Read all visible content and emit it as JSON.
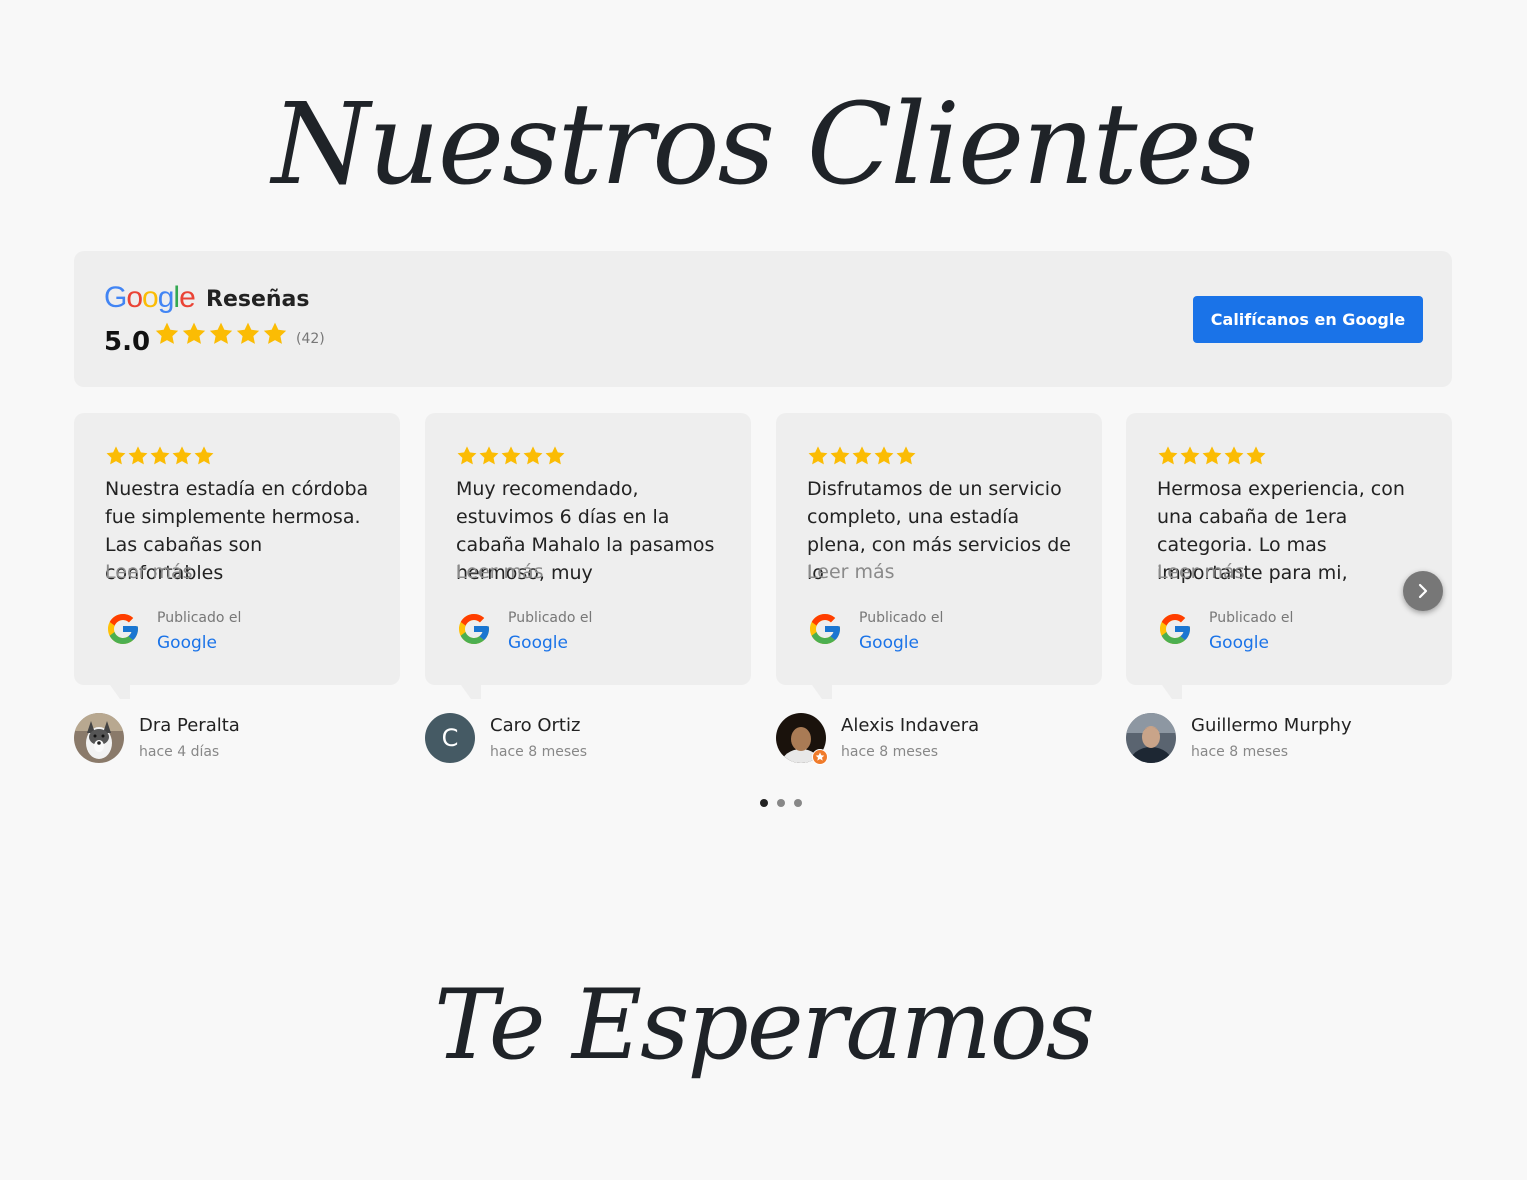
{
  "titles": {
    "top": "Nuestros Clientes",
    "bottom": "Te Esperamos"
  },
  "summary": {
    "brand_letters": [
      "G",
      "o",
      "o",
      "g",
      "l",
      "e"
    ],
    "brand_colors": [
      "#4285F4",
      "#EA4335",
      "#FBBC05",
      "#4285F4",
      "#34A853",
      "#EA4335"
    ],
    "label": "Reseñas",
    "rating": "5.0",
    "stars": 5,
    "count": "(42)",
    "cta_label": "Califícanos en Google"
  },
  "colors": {
    "accent": "#1a73e8",
    "star": "#fbbc04"
  },
  "reviews": [
    {
      "stars": 5,
      "text": "Nuestra estadía en córdoba fue simplemente hermosa. Las cabañas son confortables",
      "more": "Leer más",
      "published_label": "Publicado el",
      "source": "Google",
      "author": "Dra Peralta",
      "date": "hace 4 días",
      "avatar": "photo-dog-icon"
    },
    {
      "stars": 5,
      "text": "Muy recomendado, estuvimos 6 días en la cabaña Mahalo la pasamos hermoso, muy",
      "more": "Leer más",
      "published_label": "Publicado el",
      "source": "Google",
      "author": "Caro Ortiz",
      "date": "hace 8 meses",
      "avatar_letter": "C",
      "avatar_color": "#455a64"
    },
    {
      "stars": 5,
      "text": "Disfrutamos de un servicio completo, una estadía plena, con más servicios de lo",
      "more": "Leer más",
      "published_label": "Publicado el",
      "source": "Google",
      "author": "Alexis Indavera",
      "date": "hace 8 meses",
      "avatar": "photo-person-icon"
    },
    {
      "stars": 5,
      "text": "Hermosa experiencia, con una cabaña de 1era categoria. Lo mas importante para mi,",
      "more": "Leer más",
      "published_label": "Publicado el",
      "source": "Google",
      "author": "Guillermo Murphy",
      "date": "hace 8 meses",
      "avatar": "photo-man-icon"
    }
  ],
  "pagination": {
    "pages": 3,
    "active": 1
  }
}
